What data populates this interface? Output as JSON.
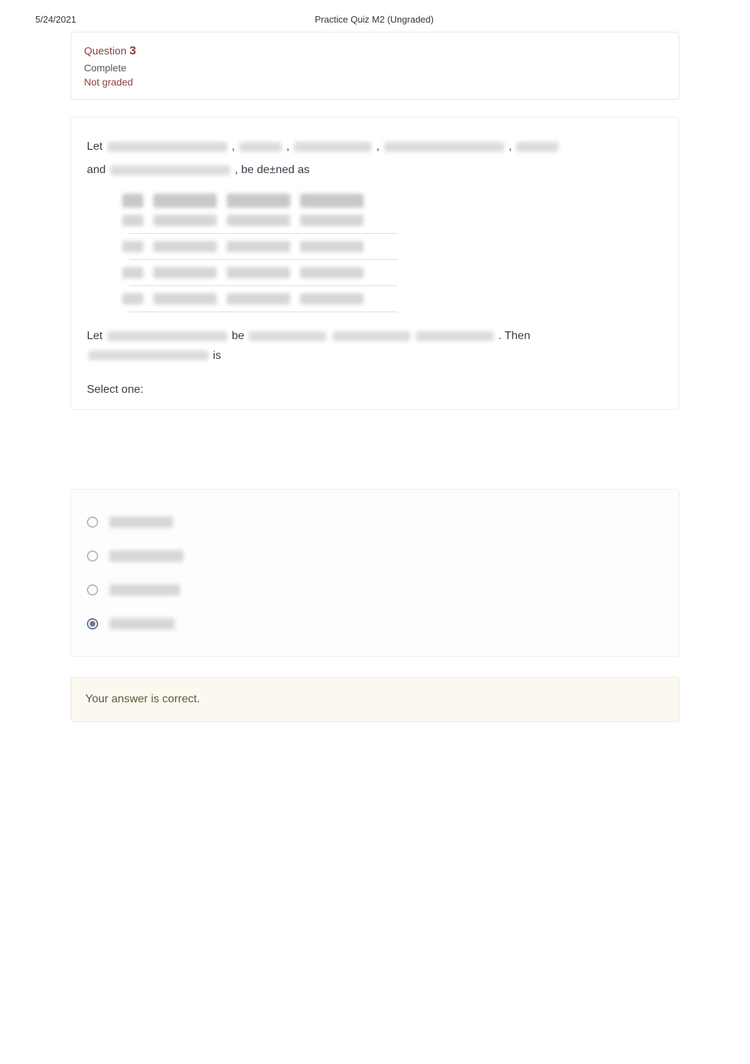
{
  "header": {
    "date": "5/24/2021",
    "title": "Practice Quiz M2 (Ungraded)"
  },
  "question": {
    "label": "Question",
    "number": "3",
    "status": "Complete",
    "grade": "Not graded"
  },
  "body": {
    "let1": "Let",
    "comma": ",",
    "and_label": "and",
    "defined_as": ", be de±ned as",
    "let2": "Let",
    "be_label": "be",
    "then_label": ". Then",
    "is_label": "is",
    "select_one": "Select one:"
  },
  "feedback": {
    "text": "Your answer is correct."
  }
}
